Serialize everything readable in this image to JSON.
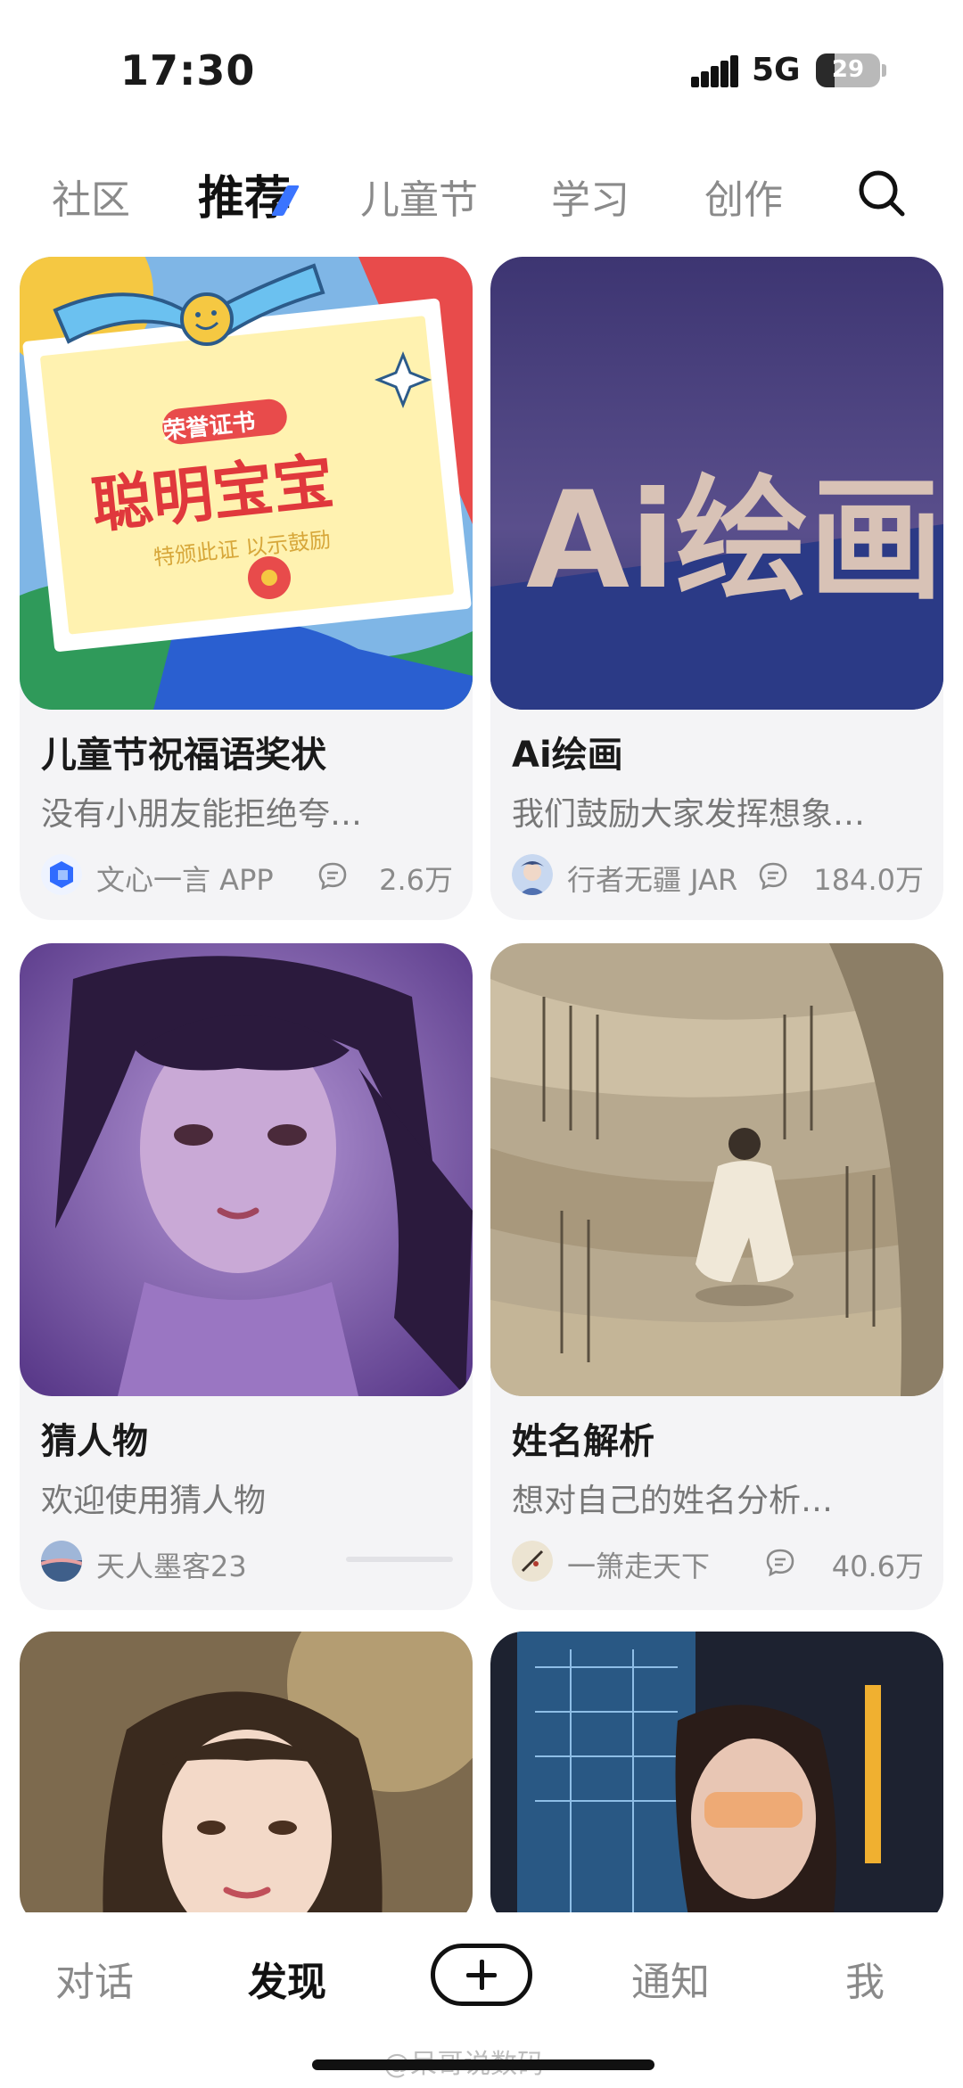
{
  "status_bar": {
    "time": "17:30",
    "network": "5G",
    "battery": "29",
    "battery_level_pct": 29
  },
  "top_tabs": [
    {
      "label": "社区",
      "active": false
    },
    {
      "label": "推荐",
      "active": true
    },
    {
      "label": "儿童节",
      "active": false
    },
    {
      "label": "学习",
      "active": false
    },
    {
      "label": "创作",
      "active": false
    }
  ],
  "cards": [
    {
      "title": "儿童节祝福语奖状",
      "desc": "没有小朋友能拒绝夸…",
      "author": "文心一言 APP",
      "count": "2.6万",
      "image": {
        "icon": "certificate-image",
        "badge": "荣誉证书",
        "heading": "聪明宝宝",
        "subtitle": "特颁此证  以示鼓励"
      }
    },
    {
      "title": "Ai绘画",
      "desc": "我们鼓励大家发挥想象…",
      "author": "行者无疆 JAR",
      "count": "184.0万",
      "image": {
        "icon": "ai-painting-banner",
        "text": "Ai绘画"
      }
    },
    {
      "title": "猜人物",
      "desc": "欢迎使用猜人物",
      "author": "天人墨客23",
      "count": "",
      "image": {
        "icon": "fantasy-girl-portrait"
      }
    },
    {
      "title": "姓名解析",
      "desc": "想对自己的姓名分析…",
      "author": "一箫走天下",
      "count": "40.6万",
      "image": {
        "icon": "ancient-scroll-figure"
      }
    },
    {
      "image": {
        "icon": "girl-portrait-photo"
      }
    },
    {
      "image": {
        "icon": "girl-tech-screen-photo"
      }
    }
  ],
  "bottom_nav": [
    {
      "label": "对话",
      "active": false
    },
    {
      "label": "发现",
      "active": true
    },
    {
      "label": "通知",
      "active": false
    },
    {
      "label": "我",
      "active": false
    }
  ],
  "watermark": "@呆哥说数码"
}
